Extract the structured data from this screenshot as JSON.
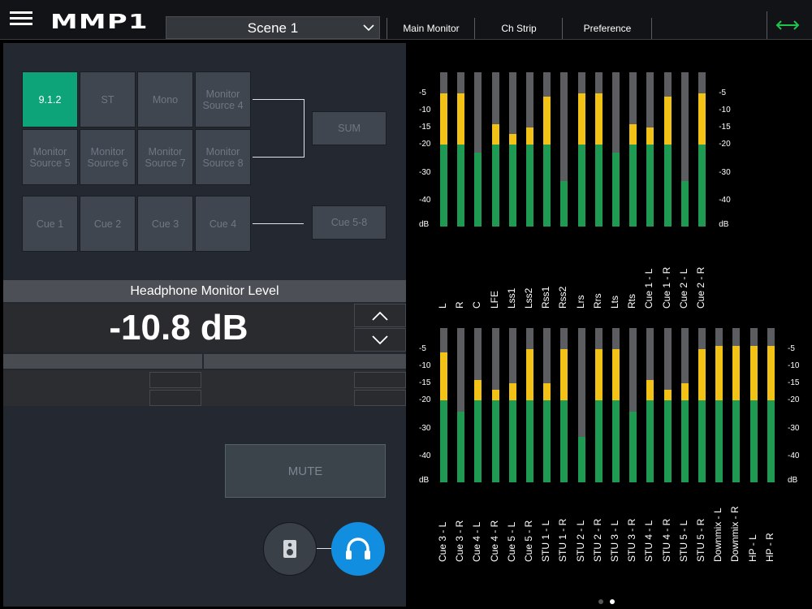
{
  "app": {
    "logo": "MMP1",
    "scene": "Scene 1"
  },
  "tabs": [
    {
      "label": "Main Monitor",
      "active": true
    },
    {
      "label": "Ch Strip",
      "active": false
    },
    {
      "label": "Preference",
      "active": false
    }
  ],
  "sources": [
    {
      "label": "9.1.2",
      "selected": true
    },
    {
      "label": "ST",
      "selected": false
    },
    {
      "label": "Mono",
      "selected": false
    },
    {
      "label": "Monitor Source 4",
      "selected": false
    },
    {
      "label": "Monitor Source 5",
      "selected": false
    },
    {
      "label": "Monitor Source 6",
      "selected": false
    },
    {
      "label": "Monitor Source 7",
      "selected": false
    },
    {
      "label": "Monitor Source 8",
      "selected": false
    }
  ],
  "sum_label": "SUM",
  "cues": [
    "Cue 1",
    "Cue 2",
    "Cue 3",
    "Cue 4"
  ],
  "cue_group_label": "Cue 5-8",
  "headphone": {
    "title": "Headphone Monitor Level",
    "value": "-10.8 dB"
  },
  "mute_label": "MUTE",
  "colors": {
    "accent": "#0ea47a",
    "active_tab": "#1ec44e",
    "meter_green": "#1e9a52",
    "meter_yellow": "#f2c316",
    "phones_blue": "#118ee0"
  },
  "meters": {
    "scale_left": [
      "-5",
      "-10",
      "-15",
      "-20",
      "-30",
      "-40",
      "dB"
    ],
    "scale_right": [
      "-5",
      "-10",
      "-15",
      "-20",
      "-30",
      "-40",
      "dB"
    ],
    "bank1": [
      {
        "label": "L",
        "level": -5
      },
      {
        "label": "R",
        "level": -5
      },
      {
        "label": "C",
        "level": -23
      },
      {
        "label": "LFE",
        "level": -14
      },
      {
        "label": "Lss1",
        "level": -17
      },
      {
        "label": "Lss2",
        "level": -15
      },
      {
        "label": "Rss1",
        "level": -6
      },
      {
        "label": "Rss2",
        "level": -33
      },
      {
        "label": "Lrs",
        "level": -5
      },
      {
        "label": "Rrs",
        "level": -5
      },
      {
        "label": "Lts",
        "level": -23
      },
      {
        "label": "Rts",
        "level": -14
      },
      {
        "label": "Cue 1 - L",
        "level": -15
      },
      {
        "label": "Cue 1 - R",
        "level": -6
      },
      {
        "label": "Cue 2 - L",
        "level": -33
      },
      {
        "label": "Cue 2 - R",
        "level": -5
      }
    ],
    "bank2": [
      {
        "label": "Cue 3 - L",
        "level": -6
      },
      {
        "label": "Cue 3 - R",
        "level": -24
      },
      {
        "label": "Cue 4 - L",
        "level": -14
      },
      {
        "label": "Cue 4 - R",
        "level": -17
      },
      {
        "label": "Cue 5 - L",
        "level": -15
      },
      {
        "label": "Cue 5 - R",
        "level": -5
      },
      {
        "label": "STU 1 - L",
        "level": -15
      },
      {
        "label": "STU 1 - R",
        "level": -5
      },
      {
        "label": "STU 2 - L",
        "level": -33
      },
      {
        "label": "STU 2 - R",
        "level": -5
      },
      {
        "label": "STU 3 - L",
        "level": -5
      },
      {
        "label": "STU 3 - R",
        "level": -24
      },
      {
        "label": "STU 4 - L",
        "level": -14
      },
      {
        "label": "STU 4 - R",
        "level": -17
      },
      {
        "label": "STU 5 - L",
        "level": -15
      },
      {
        "label": "STU 5 - R",
        "level": -5
      },
      {
        "label": "Downmix - L",
        "level": -4
      },
      {
        "label": "Downmix - R",
        "level": -4
      },
      {
        "label": "HP - L",
        "level": -4
      },
      {
        "label": "HP - R",
        "level": -4
      }
    ]
  },
  "pages": {
    "count": 2,
    "current": 2
  }
}
